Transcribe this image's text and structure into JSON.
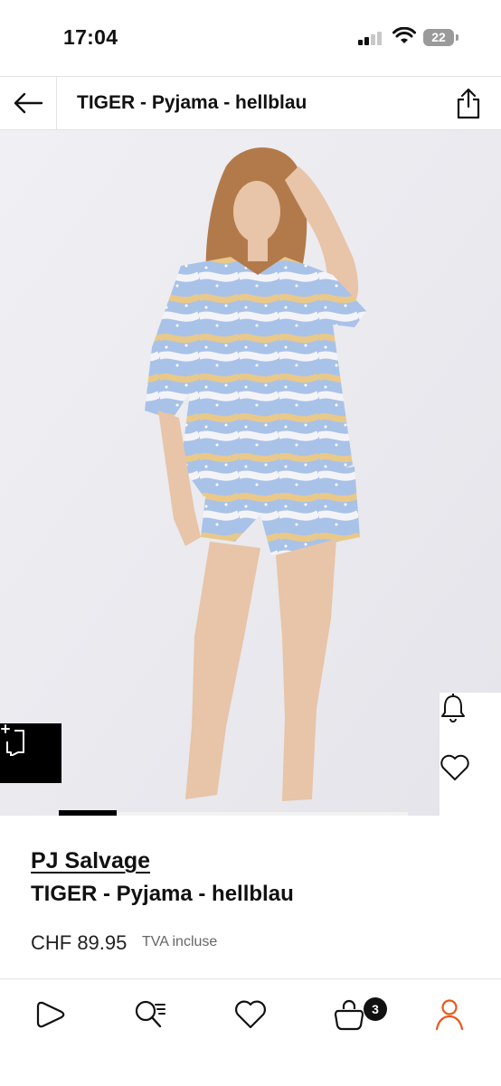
{
  "status_bar": {
    "time": "17:04",
    "battery": "22"
  },
  "header": {
    "title": "TIGER - Pyjama - hellblau",
    "back_icon": "arrow-left-icon",
    "share_icon": "share-icon"
  },
  "gallery": {
    "image_alt": "Model wearing light blue tiger print pyjama",
    "compare_icon": "compare-icon",
    "notify_icon": "bell-icon",
    "favorite_icon": "heart-icon"
  },
  "product": {
    "brand": "PJ Salvage",
    "name": "TIGER - Pyjama - hellblau",
    "price": "CHF 89.95",
    "tax_note": "TVA incluse"
  },
  "bottom_nav": {
    "items": [
      {
        "icon": "home-play-icon"
      },
      {
        "icon": "search-list-icon"
      },
      {
        "icon": "heart-icon"
      },
      {
        "icon": "bag-icon",
        "badge": "3"
      },
      {
        "icon": "profile-icon"
      }
    ]
  },
  "colors": {
    "accent": "#e8591c",
    "text": "#111111",
    "image_background": "#ebebf0"
  }
}
